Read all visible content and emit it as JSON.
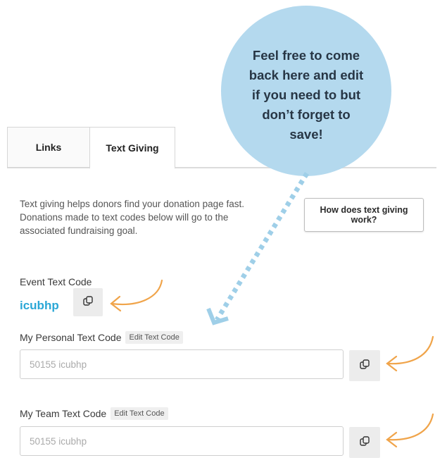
{
  "tabs": [
    {
      "label": "Links"
    },
    {
      "label": "Text Giving"
    }
  ],
  "intro_text": "Text giving helps donors find your donation page fast. Donations made to text codes below will go to the associated fundraising goal.",
  "how_button_label": "How does text giving work?",
  "event": {
    "label": "Event Text Code",
    "code": "icubhp"
  },
  "personal": {
    "label": "My Personal Text Code",
    "edit_label": "Edit Text Code",
    "placeholder": "50155 icubhp"
  },
  "team": {
    "label": "My Team Text Code",
    "edit_label": "Edit Text Code",
    "placeholder": "50155 icubhp"
  },
  "callout": {
    "text": "Feel free to come back here and edit if you need to but don’t forget to save!"
  },
  "colors": {
    "accent_code": "#2aa7d6",
    "bubble": "#b4d9ee",
    "annotation_arrow": "#f0a44a",
    "dotted_arrow": "#9fcfe8"
  },
  "icons": {
    "copy": "copy-icon"
  }
}
